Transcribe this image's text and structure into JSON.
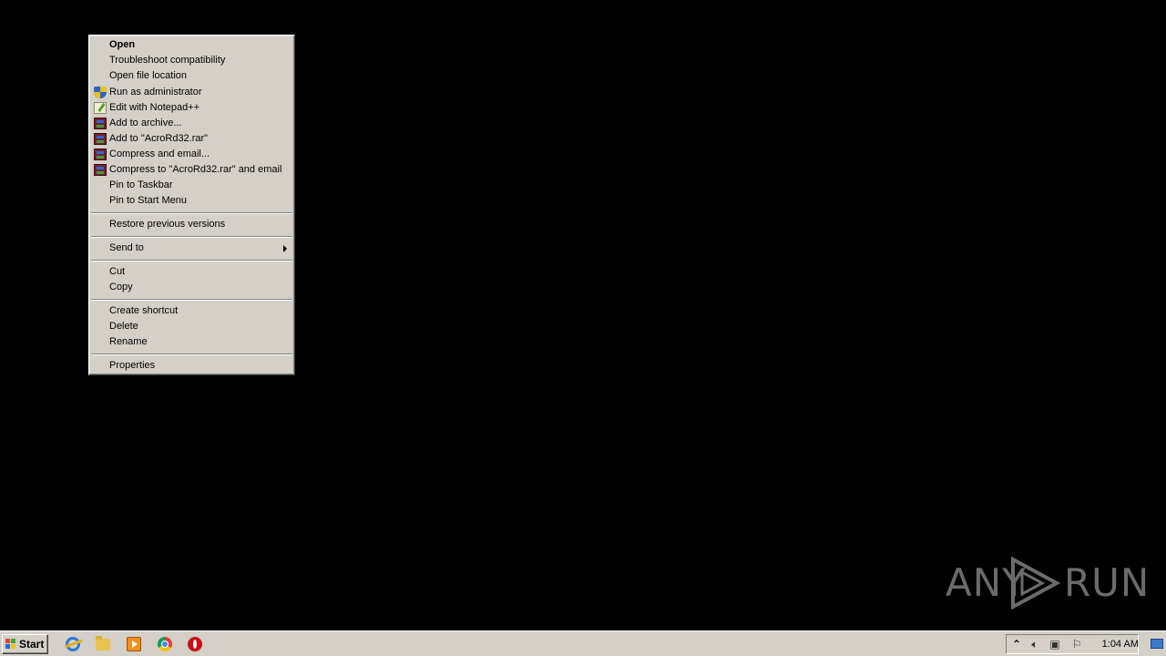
{
  "context_menu": {
    "items": [
      {
        "label": "Open",
        "bold": true
      },
      {
        "label": "Troubleshoot compatibility"
      },
      {
        "label": "Open file location"
      },
      {
        "label": "Run as administrator",
        "icon": "uac-shield-icon"
      },
      {
        "label": "Edit with Notepad++",
        "icon": "notepadpp-icon"
      },
      {
        "label": "Add to archive...",
        "icon": "winrar-icon"
      },
      {
        "label": "Add to \"AcroRd32.rar\"",
        "icon": "winrar-icon"
      },
      {
        "label": "Compress and email...",
        "icon": "winrar-icon"
      },
      {
        "label": "Compress to \"AcroRd32.rar\" and email",
        "icon": "winrar-icon"
      },
      {
        "label": "Pin to Taskbar"
      },
      {
        "label": "Pin to Start Menu"
      },
      {
        "label": "Restore previous versions"
      },
      {
        "label": "Send to",
        "submenu": true
      },
      {
        "label": "Cut"
      },
      {
        "label": "Copy"
      },
      {
        "label": "Create shortcut"
      },
      {
        "label": "Delete"
      },
      {
        "label": "Rename"
      },
      {
        "label": "Properties"
      }
    ]
  },
  "taskbar": {
    "start_label": "Start",
    "pinned": [
      "internet-explorer-icon",
      "windows-explorer-icon",
      "media-player-icon",
      "chrome-icon",
      "opera-icon"
    ],
    "tray_icons": [
      "show-hidden-icons-icon",
      "volume-icon",
      "network-icon",
      "action-center-flag-icon"
    ],
    "clock": "1:04 AM"
  },
  "watermark": {
    "left": "ANY",
    "right": "RUN"
  }
}
